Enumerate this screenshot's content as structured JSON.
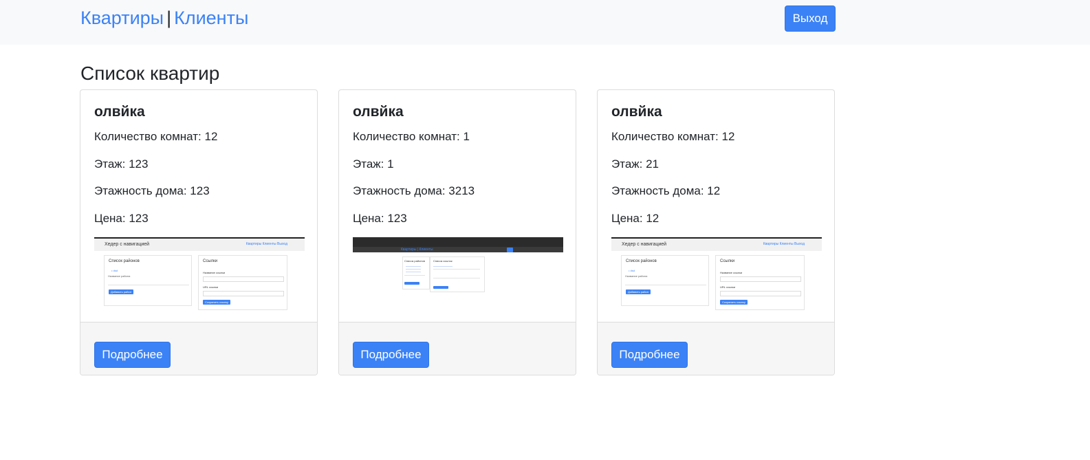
{
  "nav": {
    "link_apartments": "Квартиры",
    "separator": "|",
    "link_clients": "Клиенты",
    "logout_label": "Выход"
  },
  "page": {
    "title": "Список квартир"
  },
  "cards": [
    {
      "title": "олвйка",
      "rooms": "Количество комнат: 12",
      "floor": "Этаж: 123",
      "floors_total": "Этажность дома: 123",
      "price": "Цена: 123",
      "button": "Подробнее"
    },
    {
      "title": "олвйка",
      "rooms": "Количество комнат: 1",
      "floor": "Этаж: 1",
      "floors_total": "Этажность дома: 3213",
      "price": "Цена: 123",
      "button": "Подробнее"
    },
    {
      "title": "олвйка",
      "rooms": "Количество комнат: 12",
      "floor": "Этаж: 21",
      "floors_total": "Этажность дома: 12",
      "price": "Цена: 12",
      "button": "Подробнее"
    }
  ],
  "thumbs": {
    "header_title": "Хедер с навигацией",
    "header_links": "Квартиры Клиенты Выход",
    "districts_title": "Список районов",
    "districts_item": "• dsd",
    "districts_label": "Название района",
    "districts_button": "Добавить район",
    "links_title": "Ссылки",
    "links_field1": "Название ссылки",
    "links_field2": "URL ссылки",
    "links_button": "Сохранить ссылку",
    "nav_mini": "Квартиры | Клиенты",
    "links_list_title": "Список ссылок"
  }
}
